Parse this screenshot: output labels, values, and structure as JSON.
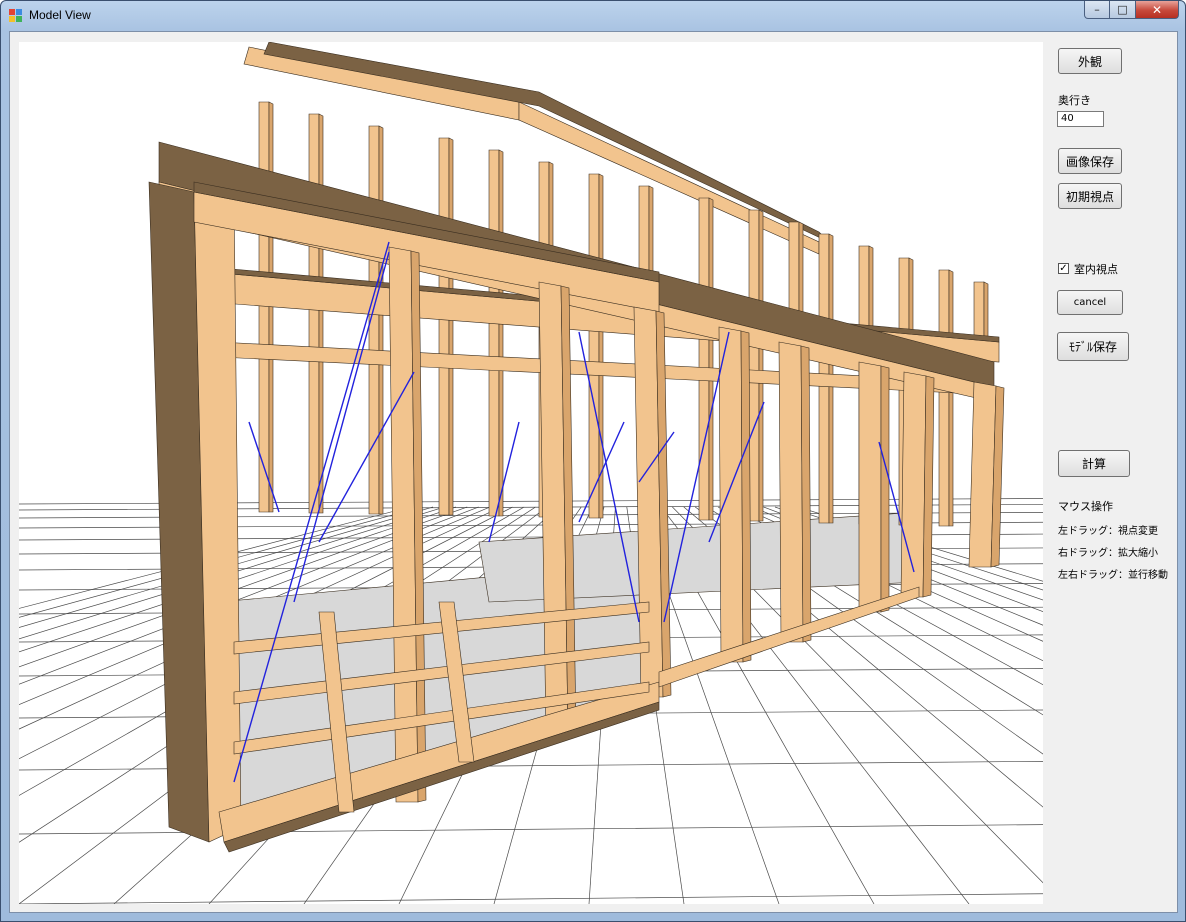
{
  "window": {
    "title": "Model View",
    "icons": {
      "app": "app-icon",
      "minimize": "minimize-icon",
      "maximize": "maximize-icon",
      "close": "close-icon"
    }
  },
  "panel": {
    "exterior_button": "外観",
    "depth_label": "奥行き",
    "depth_value": "40",
    "save_image_button": "画像保存",
    "reset_view_button": "初期視点",
    "interior_view_label": "室内視点",
    "interior_view_checked": true,
    "cancel_button": "cancel",
    "save_model_button": "ﾓﾃﾞﾙ保存",
    "calculate_button": "計算",
    "mouse_heading": "マウス操作",
    "mouse_help": [
      "左ドラッグ：視点変更",
      "右ドラッグ：拡大縮小",
      "左右ドラッグ：並行移動"
    ]
  },
  "colors": {
    "timber_face": "#f2c48e",
    "timber_side": "#d9a56c",
    "timber_dark": "#7b6244",
    "brace": "#2222dd",
    "grid": "#4a4a4a",
    "floor_panel": "#d8d8d8"
  }
}
